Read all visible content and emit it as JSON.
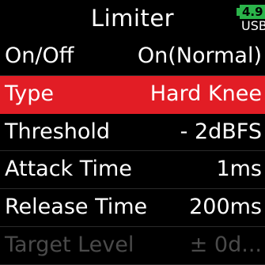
{
  "header": {
    "title": "Limiter",
    "battery": {
      "level": "4.9",
      "source": "USB",
      "color": "#2bb44a"
    }
  },
  "menu": {
    "items": [
      {
        "label": "On/Off",
        "value": "On(Normal)",
        "selected": false,
        "enabled": true
      },
      {
        "label": "Type",
        "value": "Hard Knee",
        "selected": true,
        "enabled": true
      },
      {
        "label": "Threshold",
        "value": "- 2dBFS",
        "selected": false,
        "enabled": true
      },
      {
        "label": "Attack Time",
        "value": "1ms",
        "selected": false,
        "enabled": true
      },
      {
        "label": "Release Time",
        "value": "200ms",
        "selected": false,
        "enabled": true
      },
      {
        "label": "Target Level",
        "value": "± 0d...",
        "selected": false,
        "enabled": false
      }
    ]
  },
  "colors": {
    "background": "#000000",
    "highlight": "#e21d25",
    "text": "#ffffff",
    "disabled_text": "#4a4a4a"
  }
}
